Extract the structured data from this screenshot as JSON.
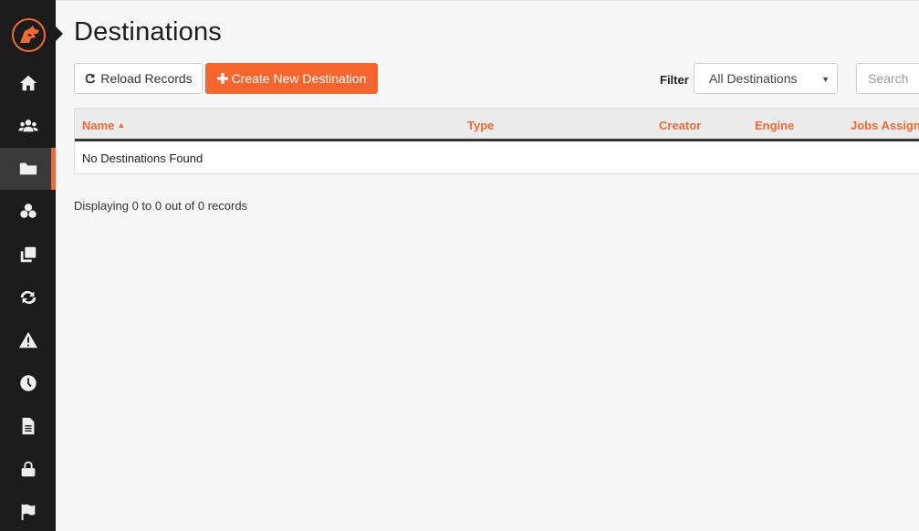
{
  "sidebar": {
    "logo": "app-logo",
    "items": [
      {
        "name": "home",
        "icon": "home-icon",
        "active": false
      },
      {
        "name": "users",
        "icon": "users-icon",
        "active": false
      },
      {
        "name": "destinations",
        "icon": "folder-icon",
        "active": true
      },
      {
        "name": "components",
        "icon": "cubes-icon",
        "active": false
      },
      {
        "name": "copies",
        "icon": "clone-icon",
        "active": false
      },
      {
        "name": "sync",
        "icon": "refresh-icon",
        "active": false
      },
      {
        "name": "alerts",
        "icon": "warning-icon",
        "active": false
      },
      {
        "name": "history",
        "icon": "clock-icon",
        "active": false
      },
      {
        "name": "documents",
        "icon": "file-icon",
        "active": false
      },
      {
        "name": "security",
        "icon": "lock-icon",
        "active": false
      },
      {
        "name": "flags",
        "icon": "flag-icon",
        "active": false
      }
    ]
  },
  "header": {
    "title": "Destinations"
  },
  "toolbar": {
    "reload_label": "Reload Records",
    "create_label": "Create New Destination",
    "filter_label": "Filter",
    "filter_value": "All Destinations",
    "search_placeholder": "Search"
  },
  "colors": {
    "accent": "#f06a35",
    "sidebar_bg": "#1b1b1b"
  },
  "table": {
    "columns": [
      {
        "label": "Name",
        "sorted": "asc"
      },
      {
        "label": "Type"
      },
      {
        "label": "Creator"
      },
      {
        "label": "Engine"
      },
      {
        "label": "Jobs Assigned"
      }
    ],
    "empty_message": "No Destinations Found"
  },
  "footer": {
    "record_count": "Displaying 0 to 0 out of 0 records"
  }
}
